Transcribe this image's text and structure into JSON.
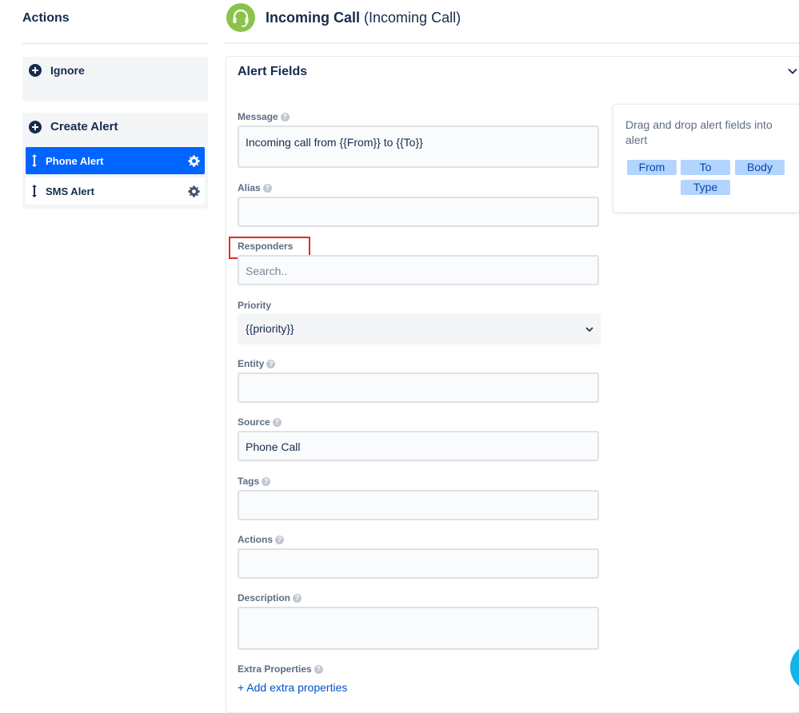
{
  "sidebar": {
    "title": "Actions",
    "ignore_label": "Ignore",
    "create_alert_label": "Create Alert",
    "alert_items": [
      {
        "label": "Phone Alert",
        "active": true
      },
      {
        "label": "SMS Alert",
        "active": false
      }
    ]
  },
  "header": {
    "title_bold": "Incoming Call",
    "title_suffix": "(Incoming Call)",
    "logo_icon": "headset-icon",
    "logo_color": "#8bc34a"
  },
  "card": {
    "title": "Alert Fields",
    "collapse_icon": "chevron-down-icon",
    "fields": {
      "message": {
        "label": "Message",
        "value": "Incoming call from {{From}} to {{To}}"
      },
      "alias": {
        "label": "Alias",
        "value": ""
      },
      "responders": {
        "label": "Responders",
        "placeholder": "Search.."
      },
      "priority": {
        "label": "Priority",
        "value": "{{priority}}"
      },
      "entity": {
        "label": "Entity",
        "value": ""
      },
      "source": {
        "label": "Source",
        "value": "Phone Call"
      },
      "tags": {
        "label": "Tags",
        "value": ""
      },
      "actions": {
        "label": "Actions",
        "value": ""
      },
      "description": {
        "label": "Description",
        "value": ""
      },
      "extra": {
        "label": "Extra Properties"
      }
    },
    "add_extra_label": "+ Add extra properties"
  },
  "dragdrop": {
    "text": "Drag and drop alert fields into alert",
    "chips": [
      "From",
      "To",
      "Body",
      "Type"
    ]
  },
  "colors": {
    "accent": "#0065ff",
    "highlight": "#e02b2b",
    "chip_bg": "#b3d4ff"
  }
}
